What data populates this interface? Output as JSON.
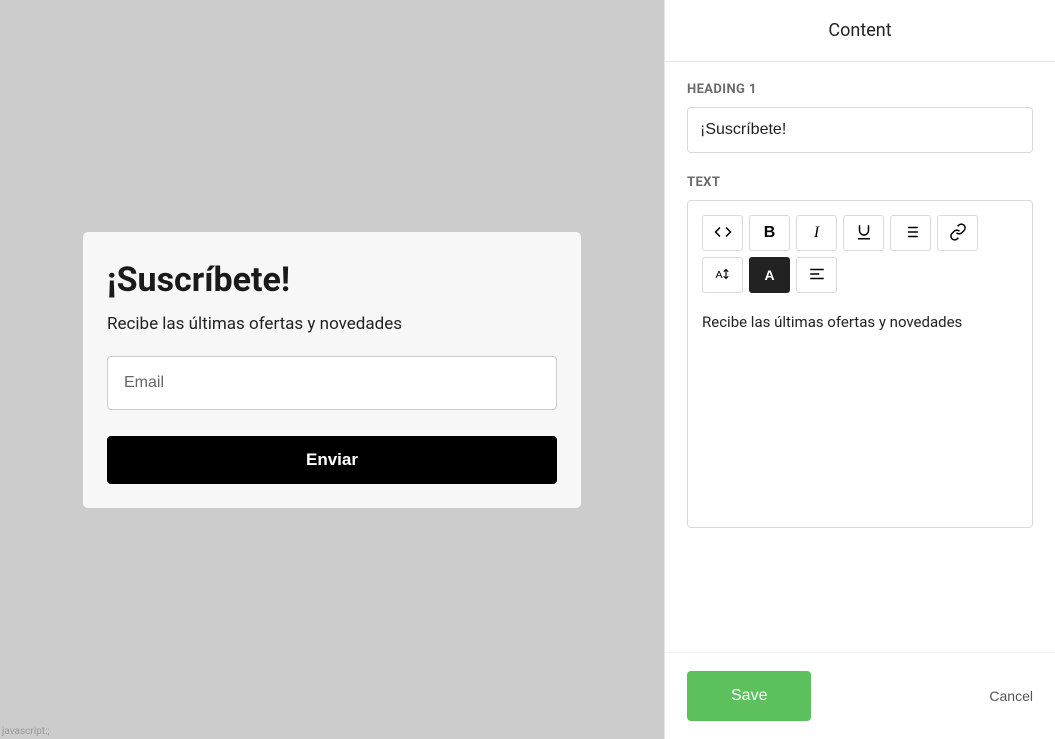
{
  "preview": {
    "heading": "¡Suscríbete!",
    "text": "Recibe las últimas ofertas y novedades",
    "email_placeholder": "Email",
    "submit_label": "Enviar"
  },
  "sidebar": {
    "title": "Content",
    "heading_label": "HEADING 1",
    "heading_value": "¡Suscríbete!",
    "text_label": "TEXT",
    "editor_text": "Recibe las últimas ofertas y novedades",
    "save_label": "Save",
    "cancel_label": "Cancel"
  },
  "status_tip": "javascript:;"
}
